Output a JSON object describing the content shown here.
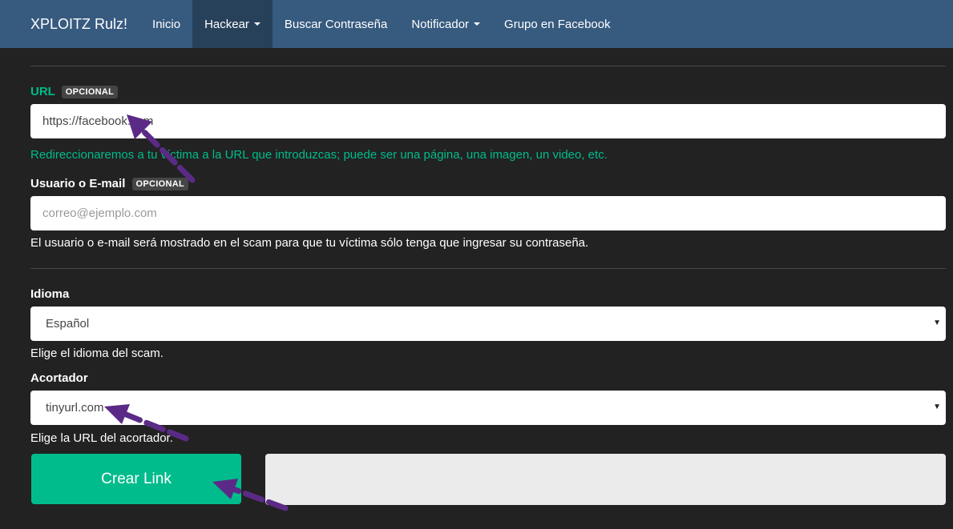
{
  "navbar": {
    "brand": "XPLOITZ Rulz!",
    "items": [
      {
        "label": "Inicio"
      },
      {
        "label": "Hackear"
      },
      {
        "label": "Buscar Contraseña"
      },
      {
        "label": "Notificador"
      },
      {
        "label": "Grupo en Facebook"
      }
    ]
  },
  "form": {
    "url": {
      "label": "URL",
      "badge": "OPCIONAL",
      "value": "https://facebook.com",
      "help": "Redireccionaremos a tu víctima a la URL que introduzcas; puede ser una página, una imagen, un video, etc."
    },
    "user": {
      "label": "Usuario o E-mail",
      "badge": "OPCIONAL",
      "placeholder": "correo@ejemplo.com",
      "help": "El usuario o e-mail será mostrado en el scam para que tu víctima sólo tenga que ingresar su contraseña."
    },
    "language": {
      "label": "Idioma",
      "selected": "Español",
      "help": "Elige el idioma del scam."
    },
    "shortener": {
      "label": "Acortador",
      "selected": "tinyurl.com",
      "help": "Elige la URL del acortador."
    },
    "submit_label": "Crear Link",
    "result_value": ""
  },
  "colors": {
    "navbar": "#375a7f",
    "navbar_active": "#28415b",
    "background": "#222222",
    "accent": "#00bc8c",
    "annotation_arrow": "#5b2a86"
  },
  "annotations": [
    "arrow-icon",
    "arrow-icon",
    "arrow-icon"
  ]
}
